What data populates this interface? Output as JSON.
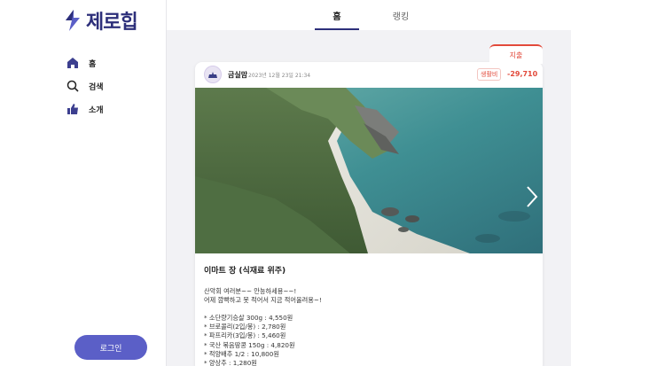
{
  "app": {
    "logo_text": "제로힙"
  },
  "sidebar": {
    "items": [
      {
        "label": "홈",
        "icon": "home-icon"
      },
      {
        "label": "검색",
        "icon": "search-icon"
      },
      {
        "label": "소개",
        "icon": "thumbs-up-icon"
      }
    ],
    "login_label": "로그인"
  },
  "tabs": [
    {
      "label": "홈",
      "active": true
    },
    {
      "label": "랭킹",
      "active": false
    }
  ],
  "post": {
    "tag": "지출",
    "username": "금실맘",
    "timestamp": "2023년 12월 23일 21:34",
    "category": "생활비",
    "amount": "-29,710",
    "title": "이마트 장 (식재료 위주)",
    "body": "산악회 여러분~~ 안뇽하세용~~!\n어제 깜빡하고 못 적어서 지금 적어올려용~!\n\n* 소단량기승살 300g : 4,550원\n* 브로콜리(2입/봉) : 2,780원\n* 파프리카(3입/봉) : 5,460원\n* 국산 볶음땅콩 150g : 4,820원\n* 적양배추 1/2 : 10,800원\n* 양상추 : 1,280원"
  },
  "colors": {
    "accent": "#5b5fc7",
    "brand": "#2d2f7a",
    "expense": "#e24a3b"
  }
}
